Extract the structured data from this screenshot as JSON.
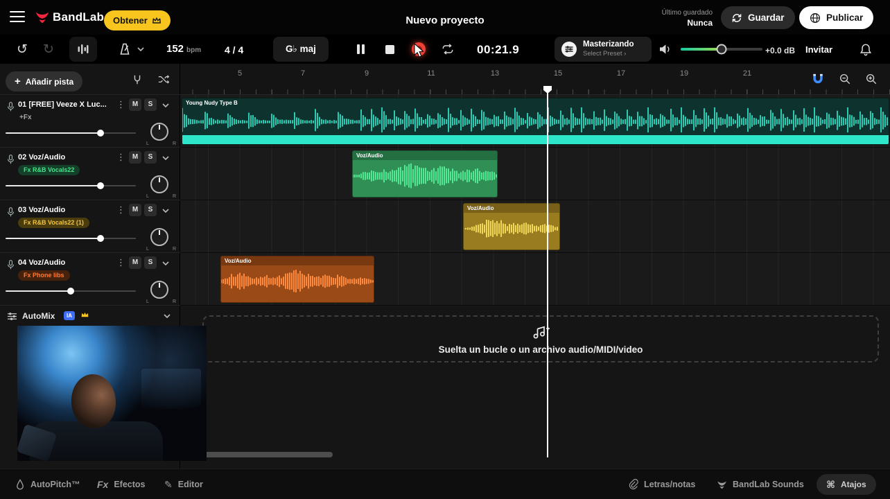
{
  "topbar": {
    "brand": "BandLab",
    "get_button": "Obtener",
    "project_title": "Nuevo proyecto",
    "last_saved_label": "Último guardado",
    "last_saved_value": "Nunca",
    "save_button": "Guardar",
    "publish_button": "Publicar"
  },
  "toolbar": {
    "bpm_value": "152",
    "bpm_unit": "bpm",
    "time_signature": "4 / 4",
    "key_signature": "G♭ maj",
    "time_display": "00:21.9",
    "mastering_title": "Masterizando",
    "mastering_subtitle": "Select Preset ›",
    "volume_db": "+0.0 dB",
    "invite_button": "Invitar"
  },
  "track_panel": {
    "add_track_button": "Añadir pista",
    "mute_label": "M",
    "solo_label": "S",
    "pan_left": "L",
    "pan_right": "R",
    "tracks": [
      {
        "number": "01",
        "name": "[FREE] Veeze X Luc...",
        "fx_label": "+Fx"
      },
      {
        "number": "02",
        "name": "Voz/Audio",
        "fx_label": "Fx R&B Vocals22"
      },
      {
        "number": "03",
        "name": "Voz/Audio",
        "fx_label": "Fx R&B Vocals22 (1)"
      },
      {
        "number": "04",
        "name": "Voz/Audio",
        "fx_label": "Fx Phone libs"
      }
    ],
    "automix_label": "AutoMix",
    "automix_badge": "IA"
  },
  "ruler": {
    "ticks": [
      "5",
      "7",
      "9",
      "11",
      "13",
      "15",
      "17",
      "19",
      "21"
    ]
  },
  "clips": [
    {
      "label": "Young Nudy Type B",
      "color": "#2ee6c9"
    },
    {
      "label": "Voz/Audio",
      "color": "#53e893"
    },
    {
      "label": "Voz/Audio",
      "color": "#f2d858"
    },
    {
      "label": "Voz/Audio",
      "color": "#ff8a3d"
    }
  ],
  "dropzone": {
    "text": "Suelta un bucle o un archivo audio/MIDI/video"
  },
  "bottombar": {
    "autopitch_label": "AutoPitch™",
    "fx_glyph": "Fx",
    "effects_label": "Efectos",
    "editor_label": "Editor",
    "lyrics_label": "Letras/notas",
    "sounds_label": "BandLab Sounds",
    "shortcuts_label": "Atajos"
  },
  "colors": {
    "accent_yellow": "#f7c51e",
    "brand_red": "#f1263c",
    "record_red": "#ee4135",
    "magnet_blue": "#3f8cff",
    "fx_green": "#45e389",
    "fx_yellow": "#f2c43c",
    "fx_orange": "#ff7b33"
  }
}
